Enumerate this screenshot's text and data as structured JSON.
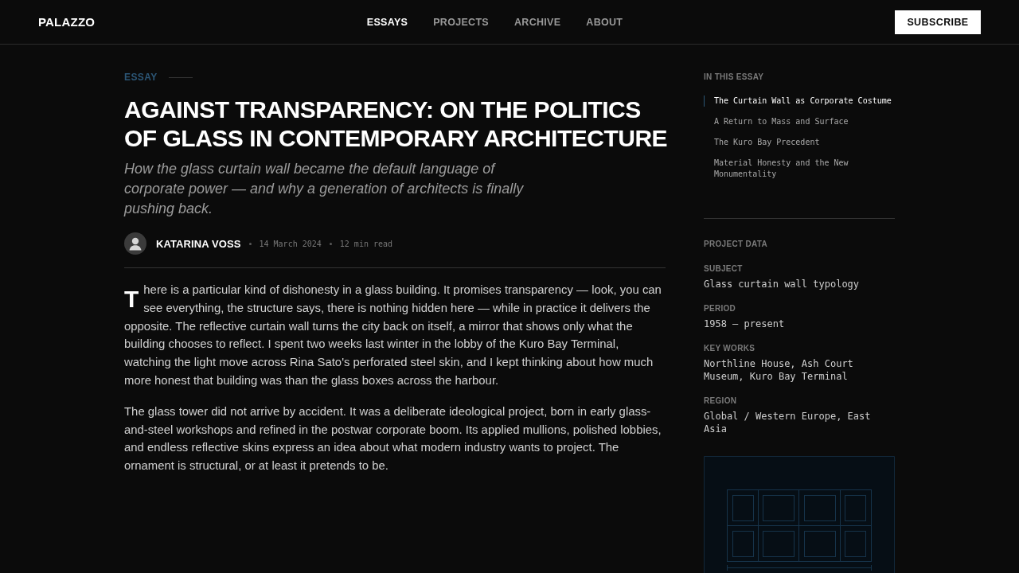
{
  "header": {
    "logo": "PALAZZO",
    "nav": [
      {
        "label": "ESSAYS",
        "selected": true
      },
      {
        "label": "PROJECTS",
        "selected": false
      },
      {
        "label": "ARCHIVE",
        "selected": false
      },
      {
        "label": "ABOUT",
        "selected": false
      }
    ],
    "subscribe": "SUBSCRIBE"
  },
  "article": {
    "category": "ESSAY",
    "title": "AGAINST TRANSPARENCY: ON THE POLITICS OF GLASS IN CONTEMPORARY ARCHITECTURE",
    "subtitle": "How the glass curtain wall became the default language of corporate power — and why a generation of architects is finally pushing back.",
    "author": "KATARINA VOSS",
    "date": "14 March 2024",
    "read_time": "12 min read",
    "paragraphs": [
      "There is a particular kind of dishonesty in a glass building. It promises transparency — look, you can see everything, the structure says, there is nothing hidden here — while in practice it delivers the opposite. The reflective curtain wall turns the city back on itself, a mirror that shows only what the building chooses to reflect. I spent two weeks last winter in the lobby of the Kuro Bay Terminal, watching the light move across Rina Sato's perforated steel skin, and I kept thinking about how much more honest that building was than the glass boxes across the harbour.",
      "The glass tower did not arrive by accident. It was a deliberate ideological project, born in early glass-and-steel workshops and refined in the postwar corporate boom. Its applied mullions, polished lobbies, and endless reflective skins express an idea about what modern industry wants to project. The ornament is structural, or at least it pretends to be."
    ]
  },
  "sidebar": {
    "toc": {
      "heading": "IN THIS ESSAY",
      "items": [
        {
          "label": "The Curtain Wall as Corporate Costume",
          "selected": true
        },
        {
          "label": "A Return to Mass and Surface",
          "selected": false
        },
        {
          "label": "The Kuro Bay Precedent",
          "selected": false
        },
        {
          "label": "Material Honesty and the New Monumentality",
          "selected": false
        }
      ]
    },
    "project_data": {
      "heading": "PROJECT DATA",
      "fields": [
        {
          "label": "SUBJECT",
          "value": "Glass curtain wall typology"
        },
        {
          "label": "PERIOD",
          "value": "1958 – present"
        },
        {
          "label": "KEY WORKS",
          "value": "Northline House, Ash Court Museum, Kuro Bay Terminal"
        },
        {
          "label": "REGION",
          "value": "Global / Western Europe, East Asia"
        }
      ]
    }
  }
}
